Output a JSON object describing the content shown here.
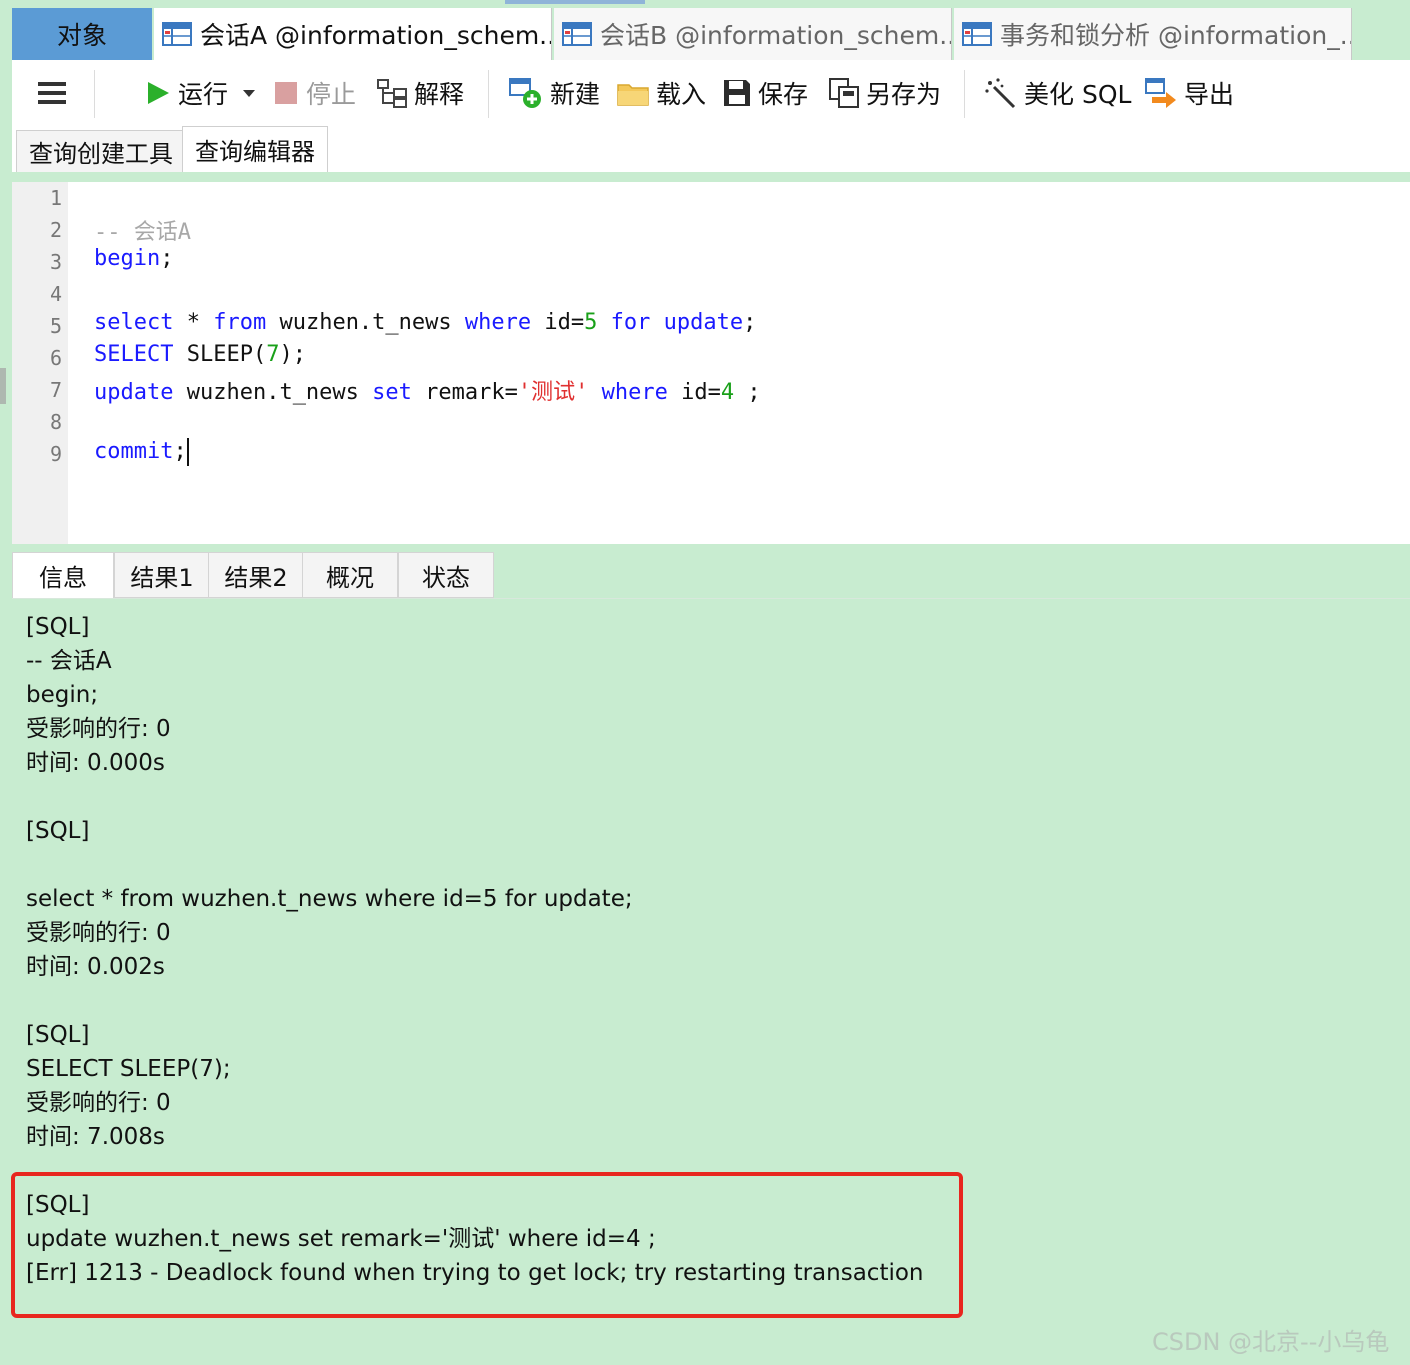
{
  "object_tabs": [
    {
      "label": "对象"
    },
    {
      "label": "会话A @information_schem..."
    },
    {
      "label": "会话B @information_schem..."
    },
    {
      "label": "事务和锁分析 @information_..."
    }
  ],
  "toolbar": {
    "run": "运行",
    "stop": "停止",
    "explain": "解释",
    "new": "新建",
    "load": "载入",
    "save": "保存",
    "save_as": "另存为",
    "beautify": "美化 SQL",
    "export": "导出"
  },
  "sub_tabs": [
    "查询创建工具",
    "查询编辑器"
  ],
  "editor": {
    "line_numbers": [
      "1",
      "2",
      "3",
      "4",
      "5",
      "6",
      "7",
      "8",
      "9"
    ],
    "comment": "-- 会话A",
    "begin": "begin",
    "select_kw": "select",
    "star": " * ",
    "from_kw": "from",
    "table": " wuzhen.t_news ",
    "where_kw": "where",
    "id_eq": " id=",
    "five": "5",
    "for_kw": "for",
    "update_kw": "update",
    "SELECT_kw": "SELECT",
    "sleep": " SLEEP(",
    "seven": "7",
    "close_paren": ");",
    "update_kw2": "update",
    "table2": " wuzhen.t_news ",
    "set_kw": "set",
    "remark": " remark=",
    "remark_value": "'测试'",
    "where_kw2": "where",
    "id_eq2": " id=",
    "four": "4",
    "semicolon_sp": " ;",
    "commit": "commit",
    "semicolon": ";"
  },
  "result_tabs": [
    "信息",
    "结果1",
    "结果2",
    "概况",
    "状态"
  ],
  "info_text": "[SQL]\n-- 会话A\nbegin;\n受影响的行: 0\n时间: 0.000s\n\n[SQL]\n\nselect * from wuzhen.t_news where id=5 for update;\n受影响的行: 0\n时间: 0.002s\n\n[SQL]\nSELECT SLEEP(7);\n受影响的行: 0\n时间: 7.008s\n\n[SQL]\nupdate wuzhen.t_news set remark='测试' where id=4 ;\n[Err] 1213 - Deadlock found when trying to get lock; try restarting transaction",
  "watermark": "CSDN @北京--小乌龟",
  "colors": {
    "background": "#c8ecd0",
    "keyword": "#1a1aff",
    "number": "#19a019",
    "string": "#e03030",
    "highlight": "#e8261e",
    "objects_tab": "#5b9bd5"
  }
}
